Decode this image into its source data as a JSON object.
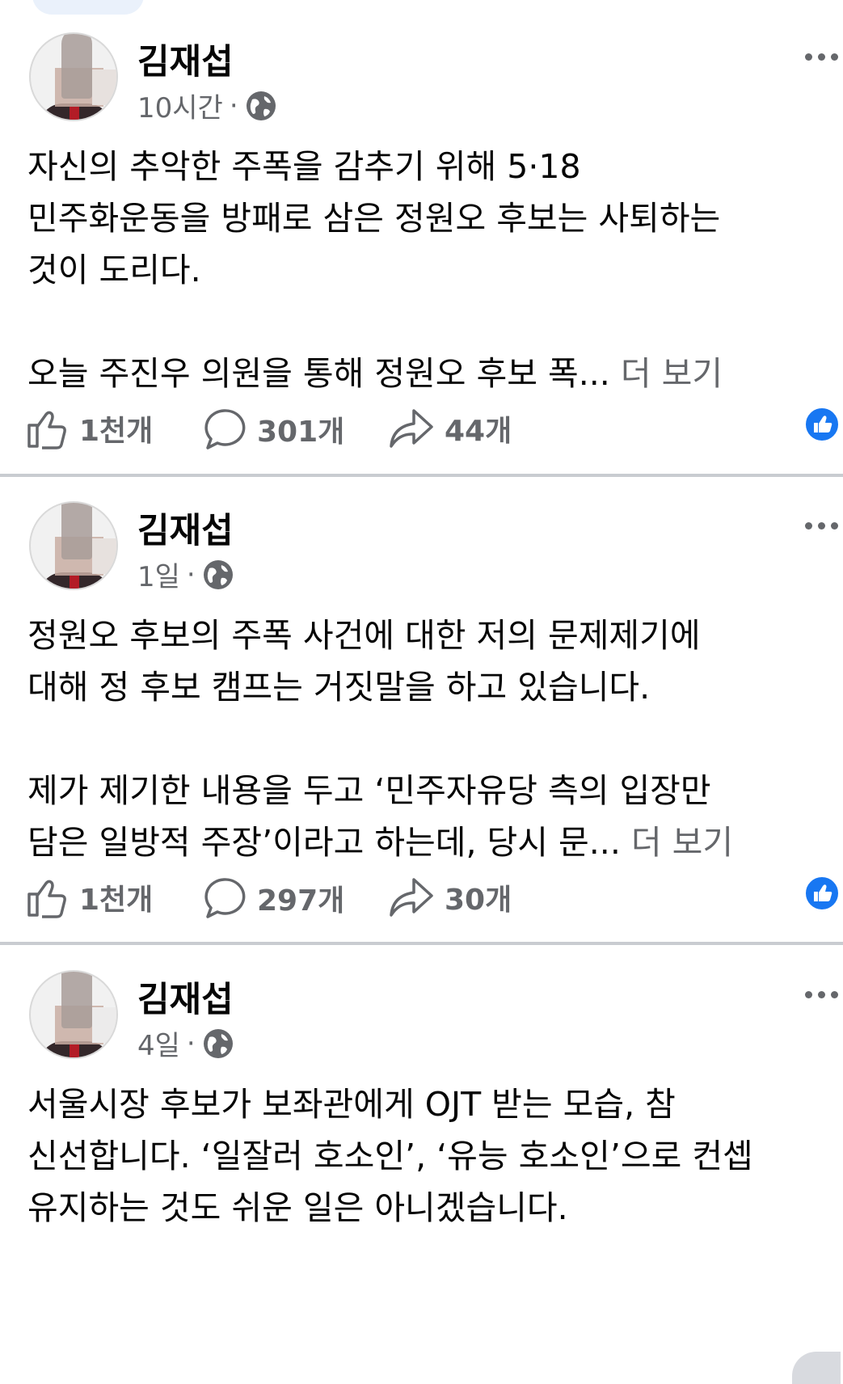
{
  "posts": [
    {
      "author": "김재섭",
      "time": "10시간",
      "separator": "·",
      "lines": [
        "자신의 추악한 주폭을 감추기 위해 5·18",
        "민주화운동을 방패로 삼은 정원오 후보는 사퇴하는",
        "것이 도리다.",
        "",
        "오늘 주진우 의원을 통해 정원오 후보 폭... "
      ],
      "see_more": "더 보기",
      "likes": "1천개",
      "comments": "301개",
      "shares": "44개"
    },
    {
      "author": "김재섭",
      "time": "1일",
      "separator": "·",
      "lines": [
        "정원오 후보의 주폭 사건에 대한 저의 문제제기에",
        "대해 정 후보 캠프는 거짓말을 하고 있습니다.",
        "",
        "제가 제기한 내용을 두고 ‘민주자유당 측의 입장만",
        "담은 일방적 주장’이라고 하는데, 당시 문... "
      ],
      "see_more": "더 보기",
      "likes": "1천개",
      "comments": "297개",
      "shares": "30개"
    },
    {
      "author": "김재섭",
      "time": "4일",
      "separator": "·",
      "lines": [
        "서울시장 후보가 보좌관에게 OJT 받는 모습, 참",
        "신선합니다. ‘일잘러 호소인’, ‘유능 호소인’으로 컨셉",
        "유지하는 것도 쉬운 일은 아니겠습니다."
      ]
    }
  ],
  "colors": {
    "text": "#050505",
    "secondary": "#65676b",
    "like_blue": "#1877f2",
    "divider": "#c9ccd1"
  },
  "icons": [
    "globe-icon",
    "more-icon",
    "like-icon",
    "comment-icon",
    "share-icon",
    "like-reaction-icon"
  ]
}
